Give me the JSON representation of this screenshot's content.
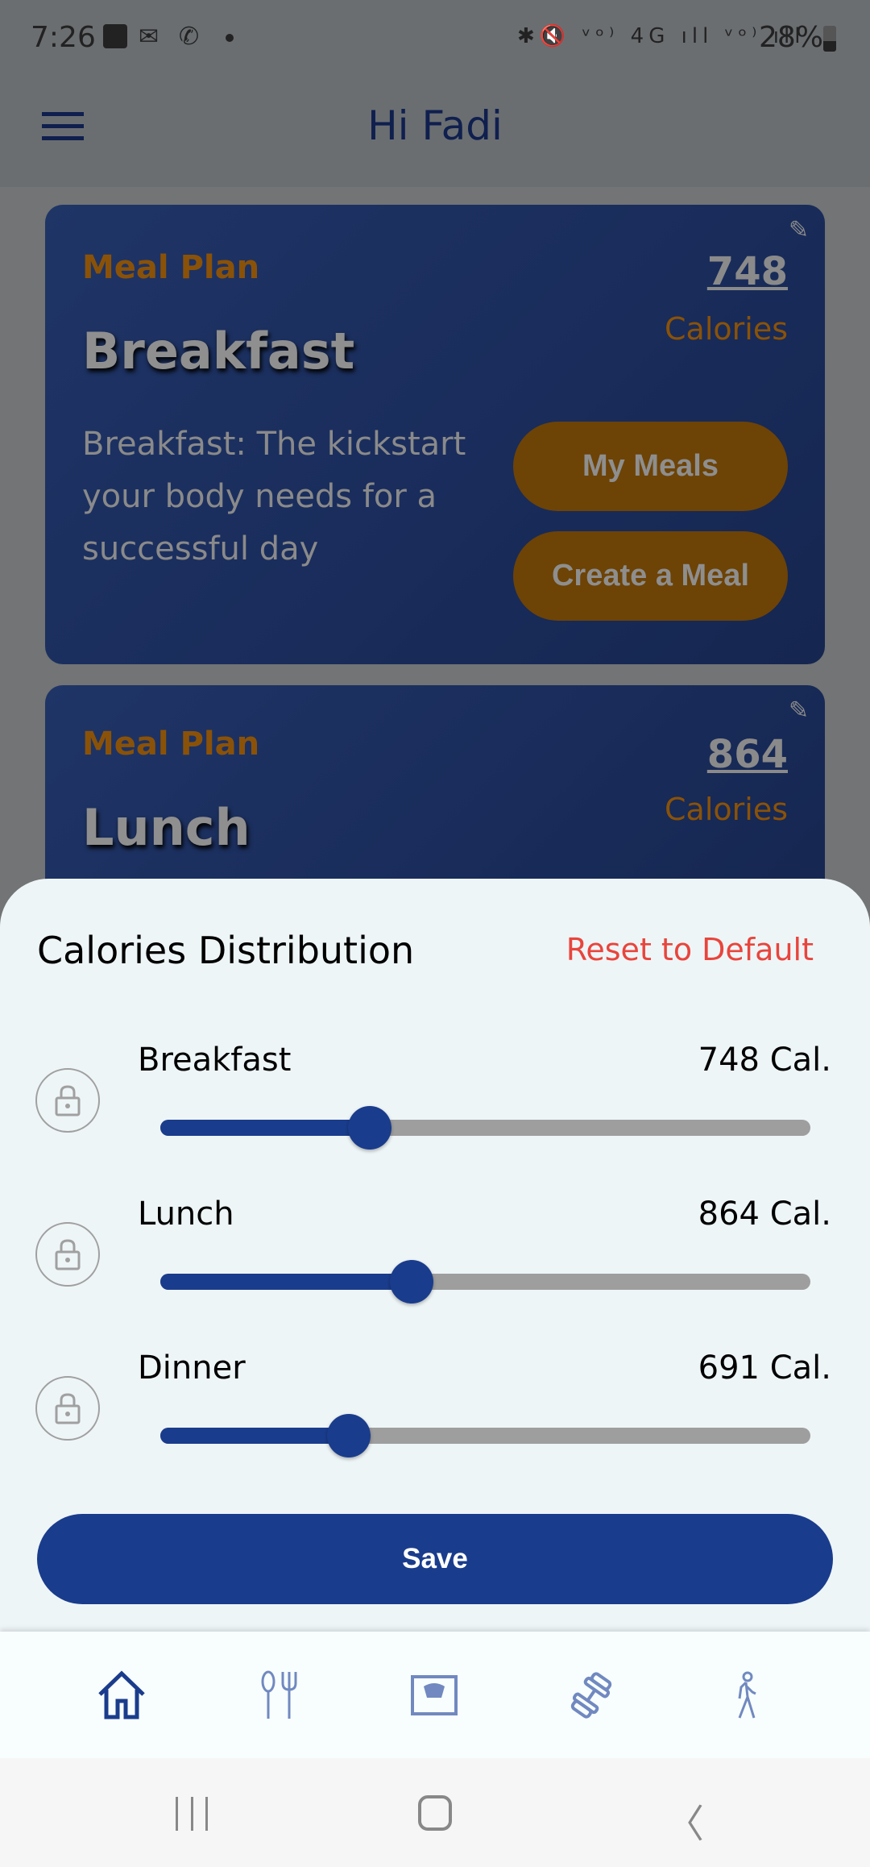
{
  "status_bar": {
    "time": "7:26",
    "battery": "28%",
    "icons": [
      "image-icon",
      "mail-icon",
      "phone-icon",
      "dot-icon",
      "bluetooth-icon",
      "mute-icon",
      "volte-lte1-icon",
      "4g-icon",
      "signal-icon",
      "volte-lte2-icon",
      "signal-icon",
      "battery-icon"
    ]
  },
  "header": {
    "title": "Hi Fadi",
    "menu_icon": "hamburger-menu-icon"
  },
  "cards": [
    {
      "kicker": "Meal Plan",
      "title": "Breakfast",
      "calories": "748",
      "calories_label": "Calories",
      "description": "Breakfast: The kickstart your body needs for a successful day",
      "buttons": [
        "My Meals",
        "Create a Meal"
      ]
    },
    {
      "kicker": "Meal Plan",
      "title": "Lunch",
      "calories": "864",
      "calories_label": "Calories"
    }
  ],
  "sheet": {
    "title": "Calories Distribution",
    "reset": "Reset to Default",
    "rows": [
      {
        "label": "Breakfast",
        "value": "748 Cal.",
        "fraction": 0.322,
        "locked": false
      },
      {
        "label": "Lunch",
        "value": "864 Cal.",
        "fraction": 0.387,
        "locked": false
      },
      {
        "label": "Dinner",
        "value": "691 Cal.",
        "fraction": 0.29,
        "locked": false
      }
    ],
    "save": "Save"
  },
  "bottom_nav": {
    "items": [
      "home-icon",
      "cutlery-icon",
      "scale-icon",
      "dumbbell-icon",
      "walking-icon"
    ],
    "active": 0
  },
  "colors": {
    "primary": "#1a3c8c",
    "accent": "#e08a10",
    "reset": "#e8453c",
    "track": "#9e9e9e",
    "sheet_bg": "#eef5f7"
  }
}
